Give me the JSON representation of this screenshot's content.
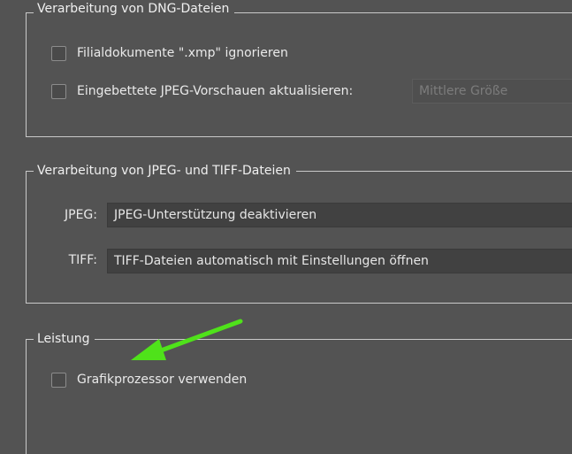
{
  "dng_section": {
    "title": "Verarbeitung von DNG-Dateien",
    "ignore_sidecar_label": "Filialdokumente \".xmp\" ignorieren",
    "update_previews_label": "Eingebettete JPEG-Vorschauen aktualisieren:",
    "preview_size_value": "Mittlere Größe"
  },
  "jpeg_tiff_section": {
    "title": "Verarbeitung von JPEG- und TIFF-Dateien",
    "jpeg_label": "JPEG:",
    "jpeg_value": "JPEG-Unterstützung deaktivieren",
    "tiff_label": "TIFF:",
    "tiff_value": "TIFF-Dateien automatisch mit Einstellungen öffnen"
  },
  "performance_section": {
    "title": "Leistung",
    "gpu_label": "Grafikprozessor verwenden"
  },
  "colors": {
    "background": "#535353",
    "annotation_arrow": "#4fe21a"
  }
}
